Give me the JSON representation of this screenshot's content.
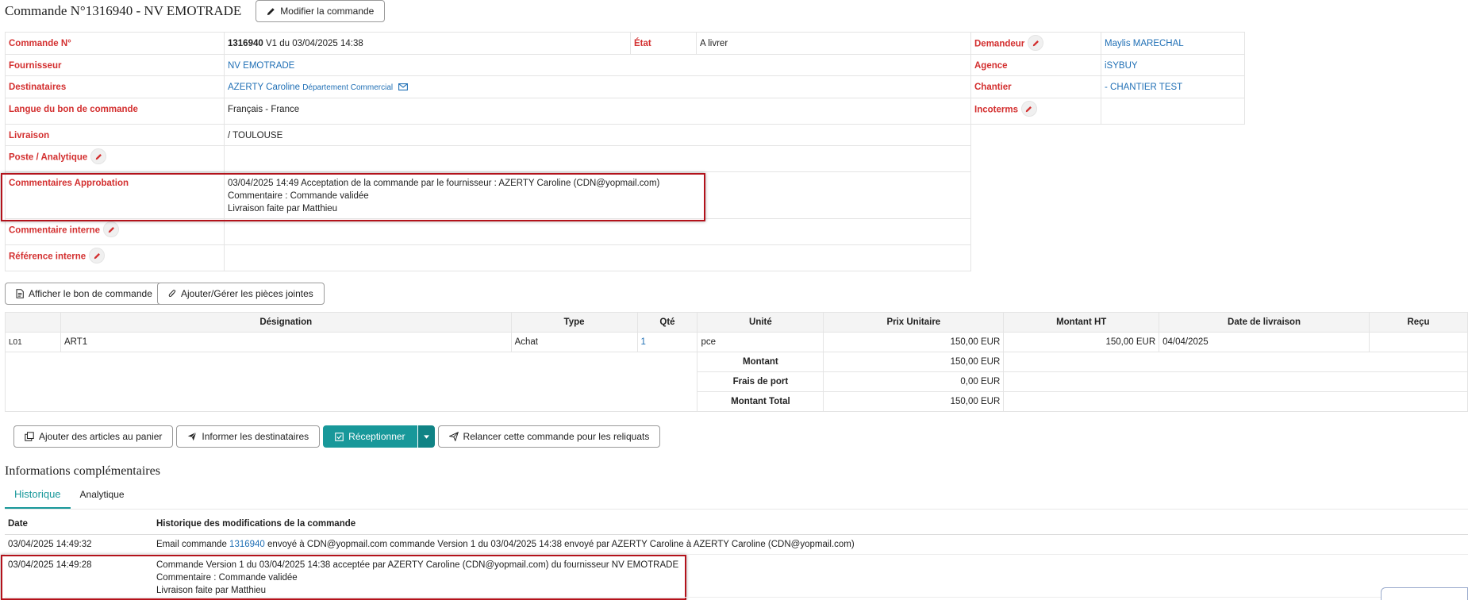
{
  "header": {
    "title": "Commande N°1316940 - NV EMOTRADE",
    "edit_button": "Modifier la commande"
  },
  "info": {
    "order_label": "Commande N°",
    "order_number": "1316940",
    "order_version": " V1 du 03/04/2025 14:38",
    "state_label": "État",
    "state_value": "A livrer",
    "requester_label": "Demandeur",
    "requester_value": "Maylis MARECHAL",
    "supplier_label": "Fournisseur",
    "supplier_value": "NV EMOTRADE",
    "agency_label": "Agence",
    "agency_value": "iSYBUY",
    "recipients_label": "Destinataires",
    "recipient_name": "AZERTY Caroline",
    "recipient_dept": "Département Commercial",
    "site_label": "Chantier",
    "site_value": "- CHANTIER TEST",
    "language_label": "Langue du bon de commande",
    "language_value": "Français - France",
    "incoterms_label": "Incoterms",
    "delivery_label": "Livraison",
    "delivery_value": "/ TOULOUSE",
    "analytic_label": "Poste / Analytique",
    "approval_label": "Commentaires Approbation",
    "approval_lines": [
      "03/04/2025 14:49 Acceptation de la commande par le fournisseur : AZERTY Caroline (CDN@yopmail.com)",
      "Commentaire : Commande validée",
      "Livraison faite par Matthieu"
    ],
    "internal_comment_label": "Commentaire interne",
    "internal_ref_label": "Référence interne"
  },
  "doc_buttons": {
    "show_order": "Afficher le bon de commande",
    "attachments": "Ajouter/Gérer les pièces jointes"
  },
  "lines_table": {
    "headers": [
      "Désignation",
      "Type",
      "Qté",
      "Unité",
      "Prix Unitaire",
      "Montant HT",
      "Date de livraison",
      "Reçu"
    ],
    "rows": [
      {
        "code": "L01",
        "designation": "ART1",
        "type": "Achat",
        "qty": "1",
        "unit": "pce",
        "unit_price": "150,00 EUR",
        "amount": "150,00 EUR",
        "delivery_date": "04/04/2025",
        "received": ""
      }
    ],
    "totals": [
      {
        "label": "Montant",
        "value": "150,00 EUR"
      },
      {
        "label": "Frais de port",
        "value": "0,00 EUR"
      },
      {
        "label": "Montant Total",
        "value": "150,00 EUR"
      }
    ]
  },
  "actions": {
    "add_to_cart": "Ajouter des articles au panier",
    "inform_recipients": "Informer les destinataires",
    "receive": "Réceptionner",
    "relaunch": "Relancer cette commande pour les reliquats"
  },
  "more_info": {
    "title": "Informations complémentaires",
    "tabs": [
      "Historique",
      "Analytique"
    ],
    "history_headers": [
      "Date",
      "Historique des modifications de la commande"
    ],
    "history": [
      {
        "date": "03/04/2025 14:49:32",
        "pre": "Email commande ",
        "link": "1316940",
        "post": " envoyé à CDN@yopmail.com commande Version 1 du 03/04/2025 14:38 envoyé par AZERTY Caroline à AZERTY Caroline (CDN@yopmail.com)"
      },
      {
        "date": "03/04/2025 14:49:28",
        "lines": [
          "Commande Version 1 du 03/04/2025 14:38 acceptée par AZERTY Caroline (CDN@yopmail.com) du fournisseur NV EMOTRADE",
          "Commentaire : Commande validée",
          "Livraison faite par Matthieu"
        ]
      }
    ]
  },
  "colors": {
    "label_red": "#d32f2f",
    "link_blue": "#1f6fb5",
    "teal": "#18989a",
    "highlight": "#b3121b"
  },
  "icons": [
    "pencil-icon",
    "envelope-icon",
    "document-icon",
    "paperclip-icon",
    "copy-icon",
    "send-icon",
    "checkbox-icon",
    "caret-down-icon"
  ]
}
